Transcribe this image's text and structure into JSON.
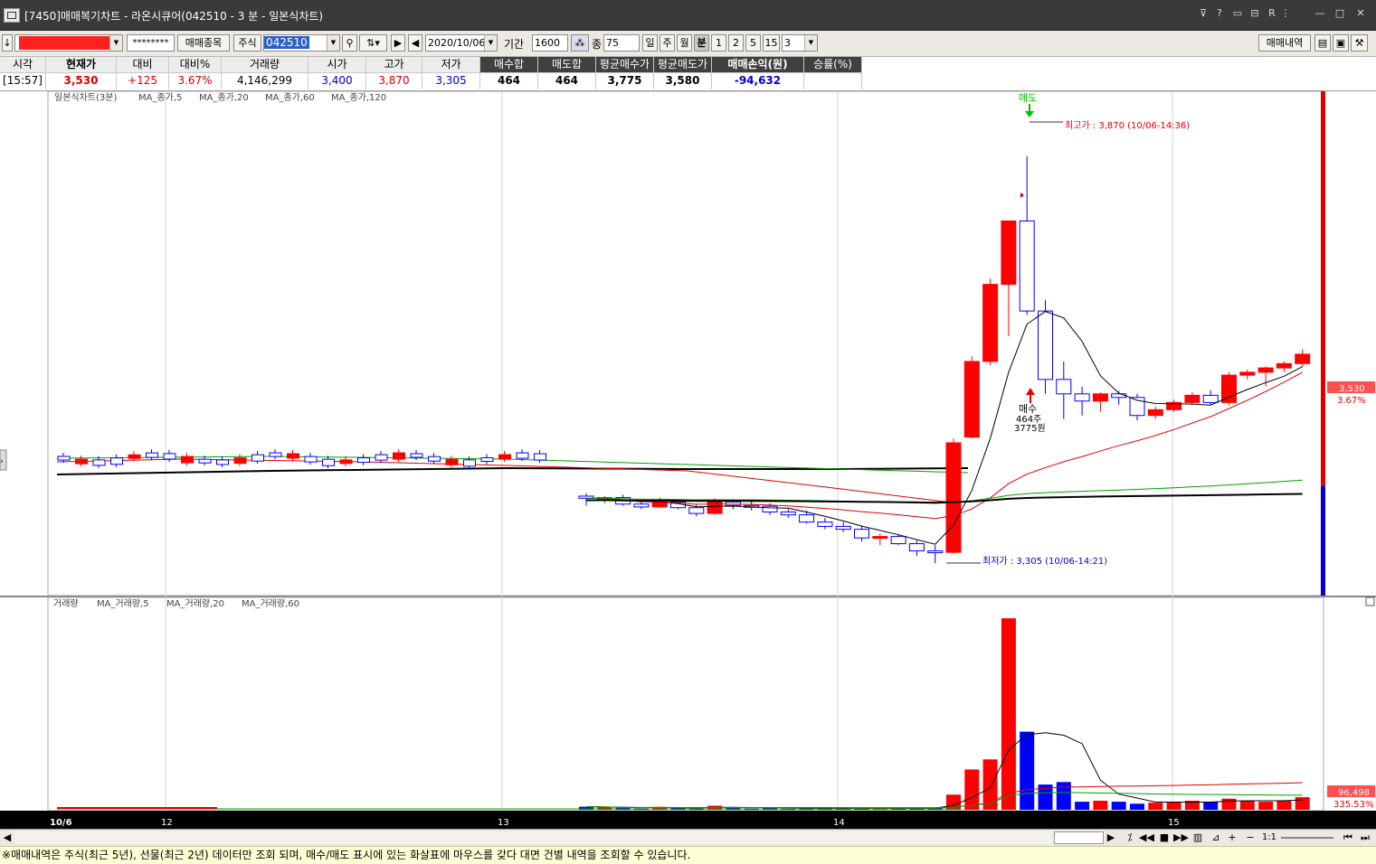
{
  "window": {
    "title": "[7450]매매복기차트 - 라온시큐어(042510 - 3 분 - 일본식차트)",
    "controls": [
      "?",
      "R",
      "—",
      "□",
      "✕"
    ]
  },
  "toolbar": {
    "account_masked": "********",
    "trade_items_label": "매매종목",
    "market_label": "주식",
    "code_value": "042510",
    "date_value": "2020/10/06",
    "period_label": "기간",
    "period_value": "1600",
    "count_label": "종",
    "count_value": "75",
    "period_buttons": [
      "일",
      "주",
      "월",
      "분"
    ],
    "minute_buttons": [
      "1",
      "2",
      "5",
      "15"
    ],
    "interval_value": "3",
    "history_button": "매매내역"
  },
  "summary": {
    "headers": [
      "시각",
      "현재가",
      "대비",
      "대비%",
      "거래량",
      "시가",
      "고가",
      "저가",
      "매수합",
      "매도합",
      "평균매수가",
      "평균매도가",
      "매매손익(원)",
      "승률(%)"
    ],
    "values": [
      "[15:57]",
      "3,530",
      "+125",
      "3.67%",
      "4,146,299",
      "3,400",
      "3,870",
      "3,305",
      "464",
      "464",
      "3,775",
      "3,580",
      "-94,632",
      ""
    ]
  },
  "price_chart": {
    "legend_title": "일본식차트(3분)",
    "legend_items": [
      "MA_종가,5",
      "MA_종가,20",
      "MA_종가,60",
      "MA_종가,120"
    ],
    "sell_marker": "매도",
    "high_annotation": "최고가 : 3,870 (10/06-14:36)",
    "low_annotation": "최저가 : 3,305 (10/06-14:21)",
    "buy_marker": "매수",
    "buy_qty": "464주",
    "buy_price": "3775원",
    "current_price_tag": "3,530",
    "current_change_tag": "3.67%"
  },
  "volume_chart": {
    "legend_title": "거래량",
    "legend_items": [
      "MA_거래량,5",
      "MA_거래량,20",
      "MA_거래량,60"
    ],
    "volume_tag": "96,498",
    "volume_pct_tag": "335.53%"
  },
  "x_axis": {
    "labels": [
      "10/6",
      "12",
      "13",
      "14",
      "15"
    ]
  },
  "footer": {
    "zoom": "1:1"
  },
  "notice": "※매매내역은 주식(최근 5년), 선물(최근 2년) 데이터만 조회 되며, 매수/매도 표시에 있는 화살표에 마우스를 갖다 대면 건별 내역을 조회할 수 있습니다.",
  "colors": {
    "up": "#ff0000",
    "down": "#0000ff",
    "ma5": "#000000",
    "ma20": "#e00000",
    "ma60": "#00a000",
    "ma120": "#000000",
    "buy_marker": "#ff0000",
    "sell_marker": "#00c000"
  },
  "chart_data": {
    "type": "candlestick",
    "ylim": [
      3270,
      3950
    ],
    "candles": [
      {
        "t": "13:24",
        "o": 3398,
        "h": 3402,
        "l": 3385,
        "c": 3395
      },
      {
        "t": "13:27",
        "o": 3395,
        "h": 3398,
        "l": 3388,
        "c": 3396
      },
      {
        "t": "13:30",
        "o": 3396,
        "h": 3400,
        "l": 3385,
        "c": 3387
      },
      {
        "t": "13:33",
        "o": 3387,
        "h": 3392,
        "l": 3380,
        "c": 3383
      },
      {
        "t": "13:36",
        "o": 3383,
        "h": 3396,
        "l": 3382,
        "c": 3390
      },
      {
        "t": "13:39",
        "o": 3390,
        "h": 3394,
        "l": 3380,
        "c": 3382
      },
      {
        "t": "13:42",
        "o": 3382,
        "h": 3386,
        "l": 3370,
        "c": 3374
      },
      {
        "t": "13:45",
        "o": 3374,
        "h": 3395,
        "l": 3372,
        "c": 3390
      },
      {
        "t": "13:48",
        "o": 3390,
        "h": 3394,
        "l": 3380,
        "c": 3385
      },
      {
        "t": "13:51",
        "o": 3385,
        "h": 3392,
        "l": 3378,
        "c": 3384
      },
      {
        "t": "13:54",
        "o": 3384,
        "h": 3388,
        "l": 3372,
        "c": 3376
      },
      {
        "t": "13:57",
        "o": 3376,
        "h": 3380,
        "l": 3368,
        "c": 3372
      },
      {
        "t": "14:00",
        "o": 3372,
        "h": 3378,
        "l": 3360,
        "c": 3362
      },
      {
        "t": "14:03",
        "o": 3362,
        "h": 3368,
        "l": 3352,
        "c": 3356
      },
      {
        "t": "14:06",
        "o": 3356,
        "h": 3362,
        "l": 3348,
        "c": 3352
      },
      {
        "t": "14:09",
        "o": 3352,
        "h": 3356,
        "l": 3335,
        "c": 3340
      },
      {
        "t": "14:12",
        "o": 3340,
        "h": 3346,
        "l": 3330,
        "c": 3342
      },
      {
        "t": "14:15",
        "o": 3342,
        "h": 3345,
        "l": 3330,
        "c": 3332
      },
      {
        "t": "14:18",
        "o": 3332,
        "h": 3336,
        "l": 3315,
        "c": 3322
      },
      {
        "t": "14:21",
        "o": 3322,
        "h": 3330,
        "l": 3305,
        "c": 3320
      },
      {
        "t": "14:24",
        "o": 3320,
        "h": 3478,
        "l": 3318,
        "c": 3472
      },
      {
        "t": "14:27",
        "o": 3480,
        "h": 3592,
        "l": 3478,
        "c": 3585
      },
      {
        "t": "14:30",
        "o": 3585,
        "h": 3700,
        "l": 3580,
        "c": 3692
      },
      {
        "t": "14:33",
        "o": 3692,
        "h": 3780,
        "l": 3620,
        "c": 3780
      },
      {
        "t": "14:36",
        "o": 3780,
        "h": 3870,
        "l": 3650,
        "c": 3655
      },
      {
        "t": "14:39",
        "o": 3655,
        "h": 3670,
        "l": 3540,
        "c": 3560
      },
      {
        "t": "14:42",
        "o": 3560,
        "h": 3585,
        "l": 3505,
        "c": 3540
      },
      {
        "t": "14:45",
        "o": 3540,
        "h": 3550,
        "l": 3510,
        "c": 3530
      },
      {
        "t": "14:48",
        "o": 3530,
        "h": 3542,
        "l": 3515,
        "c": 3540
      },
      {
        "t": "14:51",
        "o": 3540,
        "h": 3544,
        "l": 3525,
        "c": 3535
      },
      {
        "t": "14:54",
        "o": 3535,
        "h": 3540,
        "l": 3503,
        "c": 3510
      },
      {
        "t": "14:57",
        "o": 3510,
        "h": 3522,
        "l": 3505,
        "c": 3518
      },
      {
        "t": "15:00",
        "o": 3518,
        "h": 3532,
        "l": 3515,
        "c": 3528
      },
      {
        "t": "15:03",
        "o": 3528,
        "h": 3542,
        "l": 3525,
        "c": 3538
      },
      {
        "t": "15:06",
        "o": 3538,
        "h": 3545,
        "l": 3525,
        "c": 3528
      },
      {
        "t": "15:09",
        "o": 3528,
        "h": 3570,
        "l": 3524,
        "c": 3566
      },
      {
        "t": "15:12",
        "o": 3566,
        "h": 3574,
        "l": 3560,
        "c": 3570
      },
      {
        "t": "15:15",
        "o": 3570,
        "h": 3578,
        "l": 3550,
        "c": 3576
      },
      {
        "t": "15:18",
        "o": 3576,
        "h": 3585,
        "l": 3570,
        "c": 3582
      },
      {
        "t": "15:21",
        "o": 3582,
        "h": 3602,
        "l": 3578,
        "c": 3595
      }
    ],
    "volume": [
      6,
      5,
      4,
      3,
      5,
      4,
      3,
      8,
      4,
      3,
      4,
      3,
      4,
      3,
      4,
      3,
      3,
      4,
      3,
      4,
      30,
      80,
      100,
      380,
      155,
      50,
      55,
      16,
      18,
      16,
      12,
      14,
      16,
      18,
      16,
      22,
      18,
      16,
      18,
      25
    ]
  }
}
